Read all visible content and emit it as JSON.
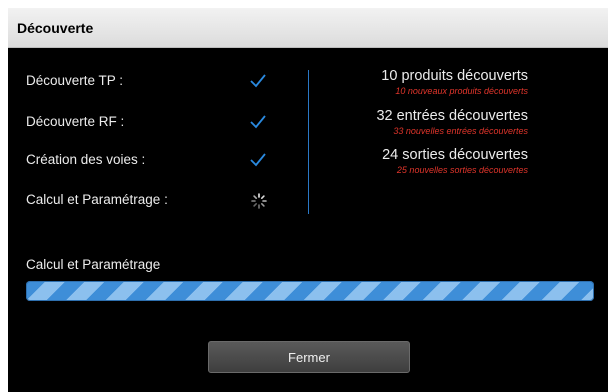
{
  "dialog": {
    "title": "Découverte",
    "steps": [
      {
        "label": "Découverte TP :",
        "status": "check-icon"
      },
      {
        "label": "Découverte RF :",
        "status": "check-icon"
      },
      {
        "label": "Création des voies :",
        "status": "check-icon"
      },
      {
        "label": "Calcul et Paramétrage :",
        "status": "spinner-icon"
      }
    ],
    "results": [
      {
        "main": "10 produits découverts",
        "sub": "10 nouveaux produits découverts"
      },
      {
        "main": "32 entrées découvertes",
        "sub": "33 nouvelles entrées découvertes"
      },
      {
        "main": "24 sorties découvertes",
        "sub": "25 nouvelles sorties découvertes"
      }
    ],
    "progress": {
      "label": "Calcul et Paramétrage",
      "value": 1.0
    },
    "close_label": "Fermer",
    "colors": {
      "accent": "#2a78c6",
      "sub_text": "#e0352b",
      "progress_stripe_dark": "#3e8ed8",
      "progress_stripe_light": "#8cc0ee"
    }
  }
}
